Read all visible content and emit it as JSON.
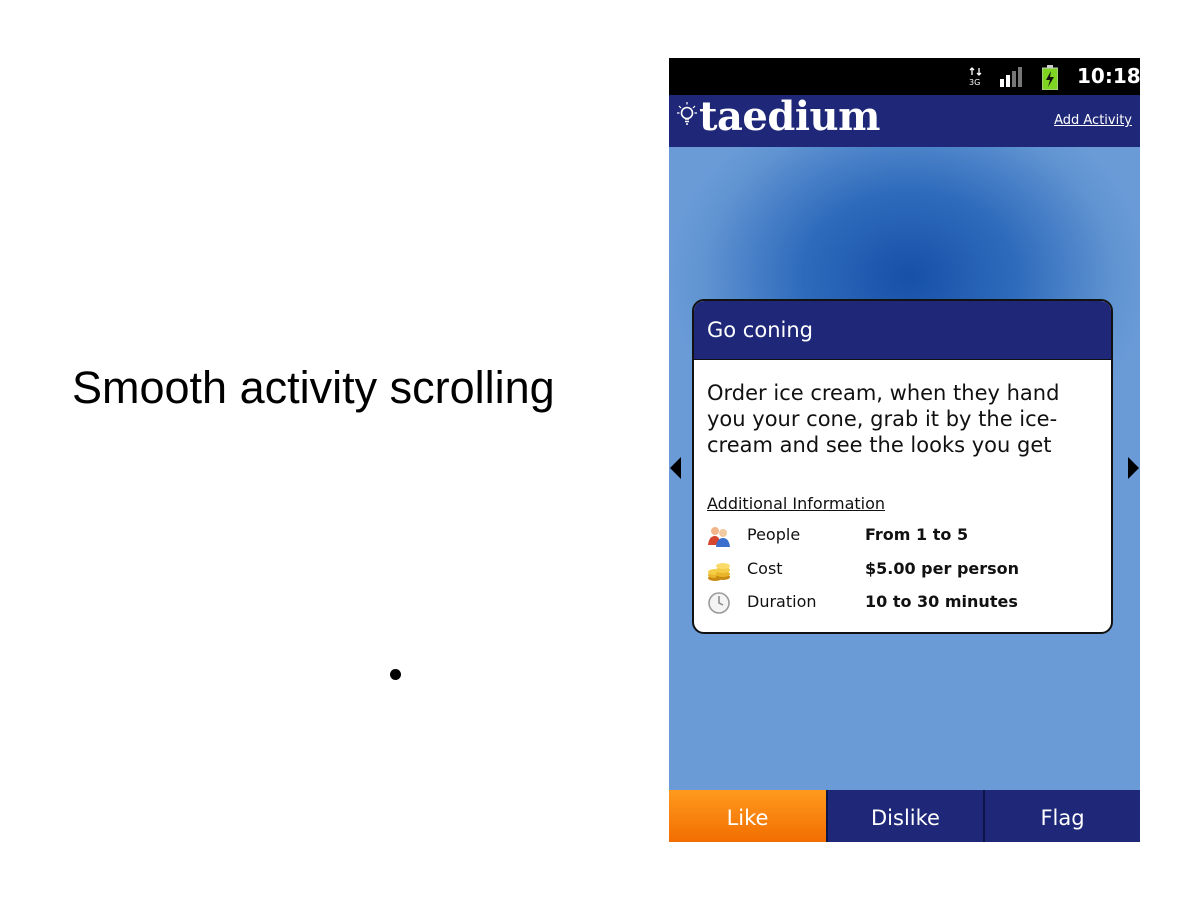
{
  "slide": {
    "caption": "Smooth activity scrolling"
  },
  "status_bar": {
    "network": "3G",
    "time": "10:18",
    "icons": [
      "data-3g-icon",
      "signal-bars-icon",
      "battery-charging-icon"
    ]
  },
  "app": {
    "logo": "taedium",
    "add_activity_label": "Add Activity"
  },
  "activity": {
    "title": "Go coning",
    "description": "Order ice cream, when they hand you your cone, grab it by the ice-cream and see the looks you get",
    "info_heading": "Additional Information",
    "info": [
      {
        "icon": "people-icon",
        "label": "People",
        "value": "From 1 to 5"
      },
      {
        "icon": "coins-icon",
        "label": "Cost",
        "value": "$5.00 per person"
      },
      {
        "icon": "clock-icon",
        "label": "Duration",
        "value": "10 to 30 minutes"
      }
    ]
  },
  "bottom_bar": {
    "like_label": "Like",
    "dislike_label": "Dislike",
    "flag_label": "Flag"
  },
  "colors": {
    "header_navy": "#1f2878",
    "like_orange": "#f58a10",
    "background_blue": "#5f93d1"
  }
}
